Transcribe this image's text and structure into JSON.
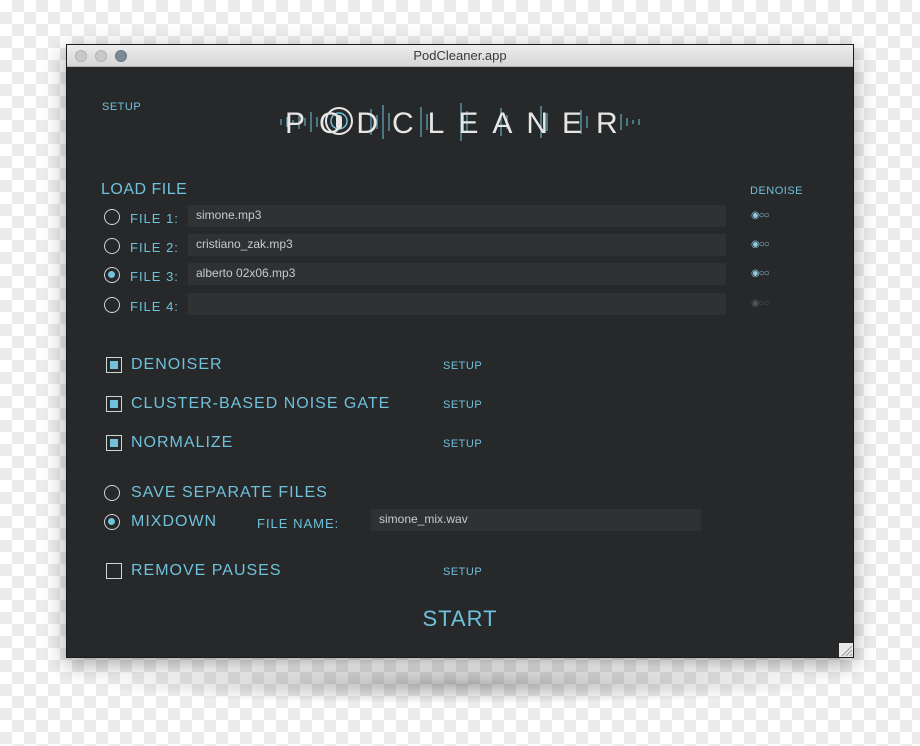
{
  "window": {
    "title": "PodCleaner.app"
  },
  "header": {
    "setup_label": "SETUP",
    "logo_text": "PODCLEANER"
  },
  "load_file": {
    "label": "LOAD FILE",
    "denoise_label": "DENOISE",
    "files": [
      {
        "label": "FILE 1:",
        "value": "simone.mp3",
        "selected": false,
        "denoise_dots": "◉○○"
      },
      {
        "label": "FILE 2:",
        "value": "cristiano_zak.mp3",
        "selected": false,
        "denoise_dots": "◉○○"
      },
      {
        "label": "FILE 3:",
        "value": "alberto 02x06.mp3",
        "selected": true,
        "denoise_dots": "◉○○"
      },
      {
        "label": "FILE 4:",
        "value": "",
        "selected": false,
        "denoise_dots": "◉○○"
      }
    ]
  },
  "options": {
    "denoiser": {
      "label": "DENOISER",
      "checked": true,
      "setup": "SETUP"
    },
    "noise_gate": {
      "label": "CLUSTER-BASED NOISE GATE",
      "checked": true,
      "setup": "SETUP"
    },
    "normalize": {
      "label": "NORMALIZE",
      "checked": true,
      "setup": "SETUP"
    }
  },
  "output": {
    "separate": {
      "label": "SAVE SEPARATE FILES",
      "selected": false
    },
    "mixdown": {
      "label": "MIXDOWN",
      "selected": true
    },
    "file_name_label": "FILE NAME:",
    "file_name_value": "simone_mix.wav"
  },
  "remove_pauses": {
    "label": "REMOVE PAUSES",
    "checked": false,
    "setup": "SETUP"
  },
  "start_label": "START",
  "colors": {
    "accent": "#6fc1dc",
    "window_bg": "#262829",
    "field_bg": "#2f3133"
  }
}
